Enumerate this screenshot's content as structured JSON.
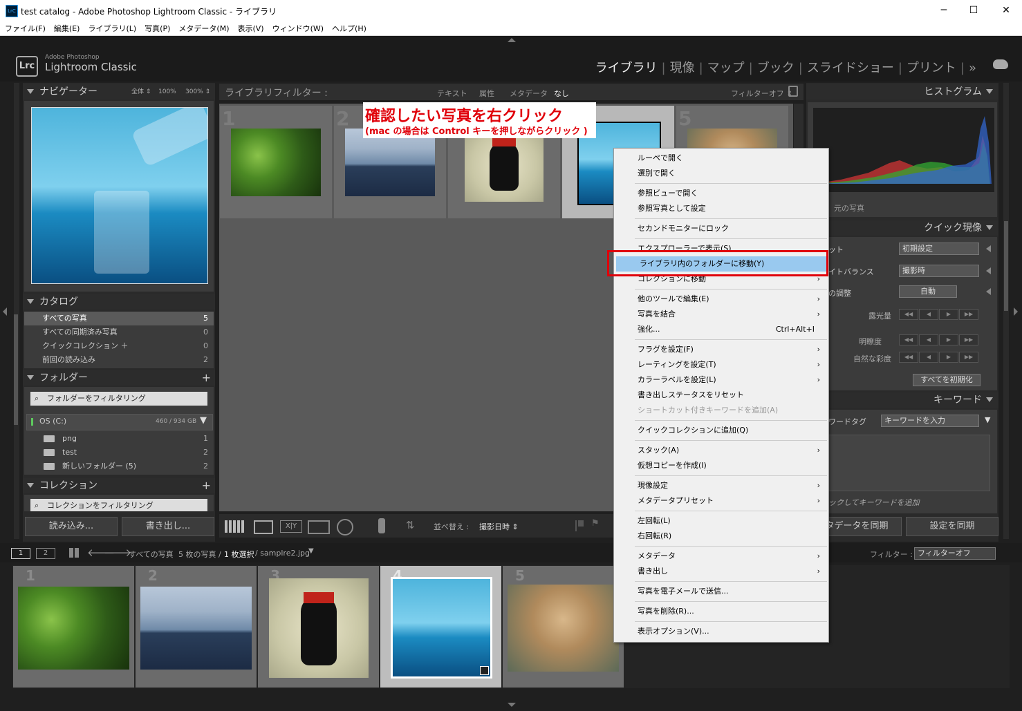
{
  "window": {
    "title": "test catalog - Adobe Photoshop Lightroom Classic - ライブラリ",
    "icon_label": "LrC",
    "minimize": "─",
    "maximize": "☐",
    "close": "✕"
  },
  "menubar": [
    "ファイル(F)",
    "編集(E)",
    "ライブラリ(L)",
    "写真(P)",
    "メタデータ(M)",
    "表示(V)",
    "ウィンドウ(W)",
    "ヘルプ(H)"
  ],
  "identity": {
    "badge": "Lrc",
    "brand_small": "Adobe Photoshop",
    "brand_large": "Lightroom Classic"
  },
  "modules": [
    "ライブラリ",
    "現像",
    "マップ",
    "ブック",
    "スライドショー",
    "プリント"
  ],
  "modules_more": "»",
  "navigator": {
    "title": "ナビゲーター",
    "zoom": [
      "全体 ⇕",
      "100%",
      "300% ⇕"
    ]
  },
  "catalog": {
    "title": "カタログ",
    "items": [
      {
        "label": "すべての写真",
        "count": "5"
      },
      {
        "label": "すべての同期済み写真",
        "count": "0"
      },
      {
        "label": "クイックコレクション ＋",
        "count": "0"
      },
      {
        "label": "前回の読み込み",
        "count": "2"
      }
    ]
  },
  "folders": {
    "title": "フォルダー",
    "plus": "+",
    "filter_placeholder": "フォルダーをフィルタリング",
    "volume": "OS (C:)",
    "volume_size": "460 / 934 GB",
    "items": [
      {
        "label": "png",
        "count": "1"
      },
      {
        "label": "test",
        "count": "2"
      },
      {
        "label": "新しいフォルダー (5)",
        "count": "2"
      }
    ]
  },
  "collections": {
    "title": "コレクション",
    "plus": "+",
    "filter_placeholder": "コレクションをフィルタリング"
  },
  "left_buttons": {
    "import": "読み込み...",
    "export": "書き出し..."
  },
  "library_filter": {
    "title": "ライブラリフィルター :",
    "options": [
      "テキスト",
      "属性",
      "メタデータ",
      "なし"
    ],
    "filter_off": "フィルターオフ ⇕"
  },
  "grid_numbers": [
    "1",
    "2",
    "3",
    "4",
    "5"
  ],
  "toolbar": {
    "sort_label": "並べ替え :",
    "sort_value": "撮影日時 ⇕"
  },
  "histogram": {
    "title": "ヒストグラム",
    "original_photo": "元の写真"
  },
  "quick_develop": {
    "title": "クイック現像",
    "preset_label": "ット",
    "preset_value": "初期設定",
    "wb_label": "イトバランス",
    "wb_value": "撮影時",
    "tone_label": "の調整",
    "auto": "自動",
    "exposure": "露光量",
    "clarity": "明瞭度",
    "vibrance": "自然な彩度",
    "reset_all": "すべてを初期化"
  },
  "keywords": {
    "title": "キーワード",
    "tag_label": "ワードタグ",
    "tag_value": "キーワードを入力",
    "hint": "ックしてキーワードを追加"
  },
  "right_buttons": {
    "sync_meta": "タデータを同期",
    "sync_settings": "設定を同期"
  },
  "filmstrip_bar": {
    "view1": "1",
    "view2": "2",
    "source": "すべての写真",
    "count_text": "5 枚の写真 /",
    "selected": "1 枚選択",
    "filename": "/ samplre2.jpg",
    "filter_label": "フィルター :",
    "filter_value": "フィルターオフ"
  },
  "annotation": {
    "line1": "確認したい写真を右クリック",
    "line2": "(mac の場合は Control キーを押しながらクリック )"
  },
  "context_menu": {
    "groups": [
      [
        {
          "label": "ルーペで開く"
        },
        {
          "label": "選別で開く"
        }
      ],
      [
        {
          "label": "参照ビューで開く"
        },
        {
          "label": "参照写真として設定"
        }
      ],
      [
        {
          "label": "セカンドモニターにロック"
        }
      ],
      [
        {
          "label": "エクスプローラーで表示(S)"
        },
        {
          "label": "ライブラリ内のフォルダーに移動(Y)",
          "highlight": true
        },
        {
          "label": "コレクションに移動",
          "submenu": true
        }
      ],
      [
        {
          "label": "他のツールで編集(E)",
          "submenu": true
        },
        {
          "label": "写真を結合",
          "submenu": true
        },
        {
          "label": "強化...",
          "accel": "Ctrl+Alt+I"
        }
      ],
      [
        {
          "label": "フラグを設定(F)",
          "submenu": true
        },
        {
          "label": "レーティングを設定(T)",
          "submenu": true
        },
        {
          "label": "カラーラベルを設定(L)",
          "submenu": true
        },
        {
          "label": "書き出しステータスをリセット"
        },
        {
          "label": "ショートカット付きキーワードを追加(A)",
          "disabled": true
        }
      ],
      [
        {
          "label": "クイックコレクションに追加(Q)"
        }
      ],
      [
        {
          "label": "スタック(A)",
          "submenu": true
        },
        {
          "label": "仮想コピーを作成(I)"
        }
      ],
      [
        {
          "label": "現像設定",
          "submenu": true
        },
        {
          "label": "メタデータプリセット",
          "submenu": true
        }
      ],
      [
        {
          "label": "左回転(L)"
        },
        {
          "label": "右回転(R)"
        }
      ],
      [
        {
          "label": "メタデータ",
          "submenu": true
        },
        {
          "label": "書き出し",
          "submenu": true
        }
      ],
      [
        {
          "label": "写真を電子メールで送信..."
        }
      ],
      [
        {
          "label": "写真を削除(R)..."
        }
      ],
      [
        {
          "label": "表示オプション(V)..."
        }
      ]
    ]
  },
  "colors": {
    "highlight": "#99c9ef",
    "annotation_red": "#e0000a",
    "panel": "#3b3b3b"
  }
}
